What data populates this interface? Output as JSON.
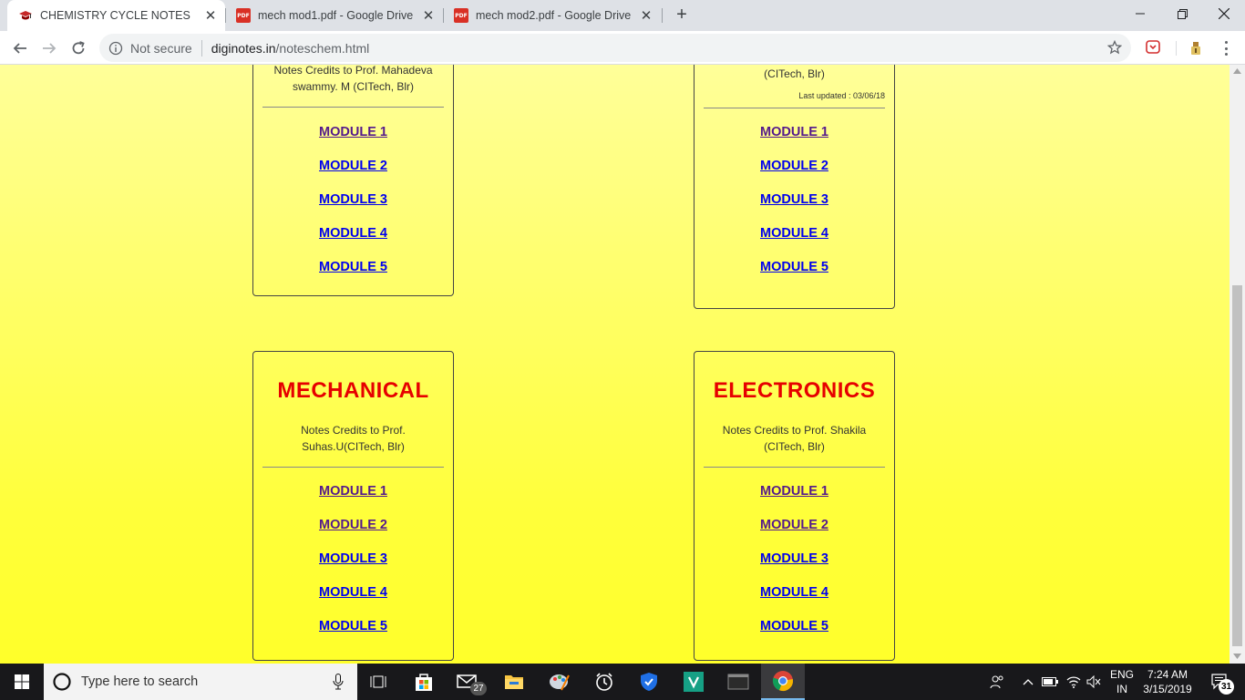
{
  "browser": {
    "tabs": [
      {
        "title": "CHEMISTRY CYCLE NOTES",
        "icon": "graduation-cap-icon",
        "active": true
      },
      {
        "title": "mech mod1.pdf - Google Drive",
        "icon": "pdf-icon",
        "active": false
      },
      {
        "title": "mech mod2.pdf - Google Drive",
        "icon": "pdf-icon",
        "active": false
      }
    ],
    "pdf_badge": "PDF",
    "close_glyph": "✕",
    "new_tab_glyph": "+",
    "security_label": "Not secure",
    "url_host": "diginotes.in",
    "url_path": "/noteschem.html"
  },
  "cards": [
    {
      "id": "top-left",
      "branch": "",
      "credits": [
        "Notes Credits to Prof. Mahadeva",
        "swammy. M (CITech, Blr)"
      ],
      "updated": "",
      "modules": [
        {
          "label": "MODULE 1",
          "visited": true
        },
        {
          "label": "MODULE 2",
          "visited": false
        },
        {
          "label": "MODULE 3",
          "visited": false
        },
        {
          "label": "MODULE 4",
          "visited": false
        },
        {
          "label": "MODULE 5",
          "visited": false
        }
      ]
    },
    {
      "id": "top-right",
      "branch": "",
      "credits": [
        "(CITech, Blr)"
      ],
      "updated": "Last updated : 03/06/18",
      "modules": [
        {
          "label": "MODULE 1",
          "visited": true
        },
        {
          "label": "MODULE 2",
          "visited": false
        },
        {
          "label": "MODULE 3",
          "visited": false
        },
        {
          "label": "MODULE 4",
          "visited": false
        },
        {
          "label": "MODULE 5",
          "visited": false
        }
      ]
    },
    {
      "id": "mechanical",
      "branch": "MECHANICAL",
      "credits": [
        "Notes Credits to Prof.",
        "Suhas.U(CITech, Blr)"
      ],
      "updated": "",
      "modules": [
        {
          "label": "MODULE 1",
          "visited": true
        },
        {
          "label": "MODULE 2",
          "visited": true
        },
        {
          "label": "MODULE 3",
          "visited": false
        },
        {
          "label": "MODULE 4",
          "visited": false
        },
        {
          "label": "MODULE 5",
          "visited": false
        }
      ]
    },
    {
      "id": "electronics",
      "branch": "ELECTRONICS",
      "credits": [
        "Notes Credits to Prof. Shakila",
        "(CITech, Blr)"
      ],
      "updated": "",
      "modules": [
        {
          "label": "MODULE 1",
          "visited": true
        },
        {
          "label": "MODULE 2",
          "visited": true
        },
        {
          "label": "MODULE 3",
          "visited": false
        },
        {
          "label": "MODULE 4",
          "visited": false
        },
        {
          "label": "MODULE 5",
          "visited": false
        }
      ]
    }
  ],
  "taskbar": {
    "search_placeholder": "Type here to search",
    "mail_badge": "27",
    "language": "ENG",
    "region": "IN",
    "time": "7:24 AM",
    "date": "3/15/2019",
    "notification_count": "31"
  },
  "colors": {
    "branch_red": "#e60000",
    "link_visited": "#551a8b",
    "link_unvisited": "#0000ee",
    "page_yellow": "#ffff66"
  }
}
